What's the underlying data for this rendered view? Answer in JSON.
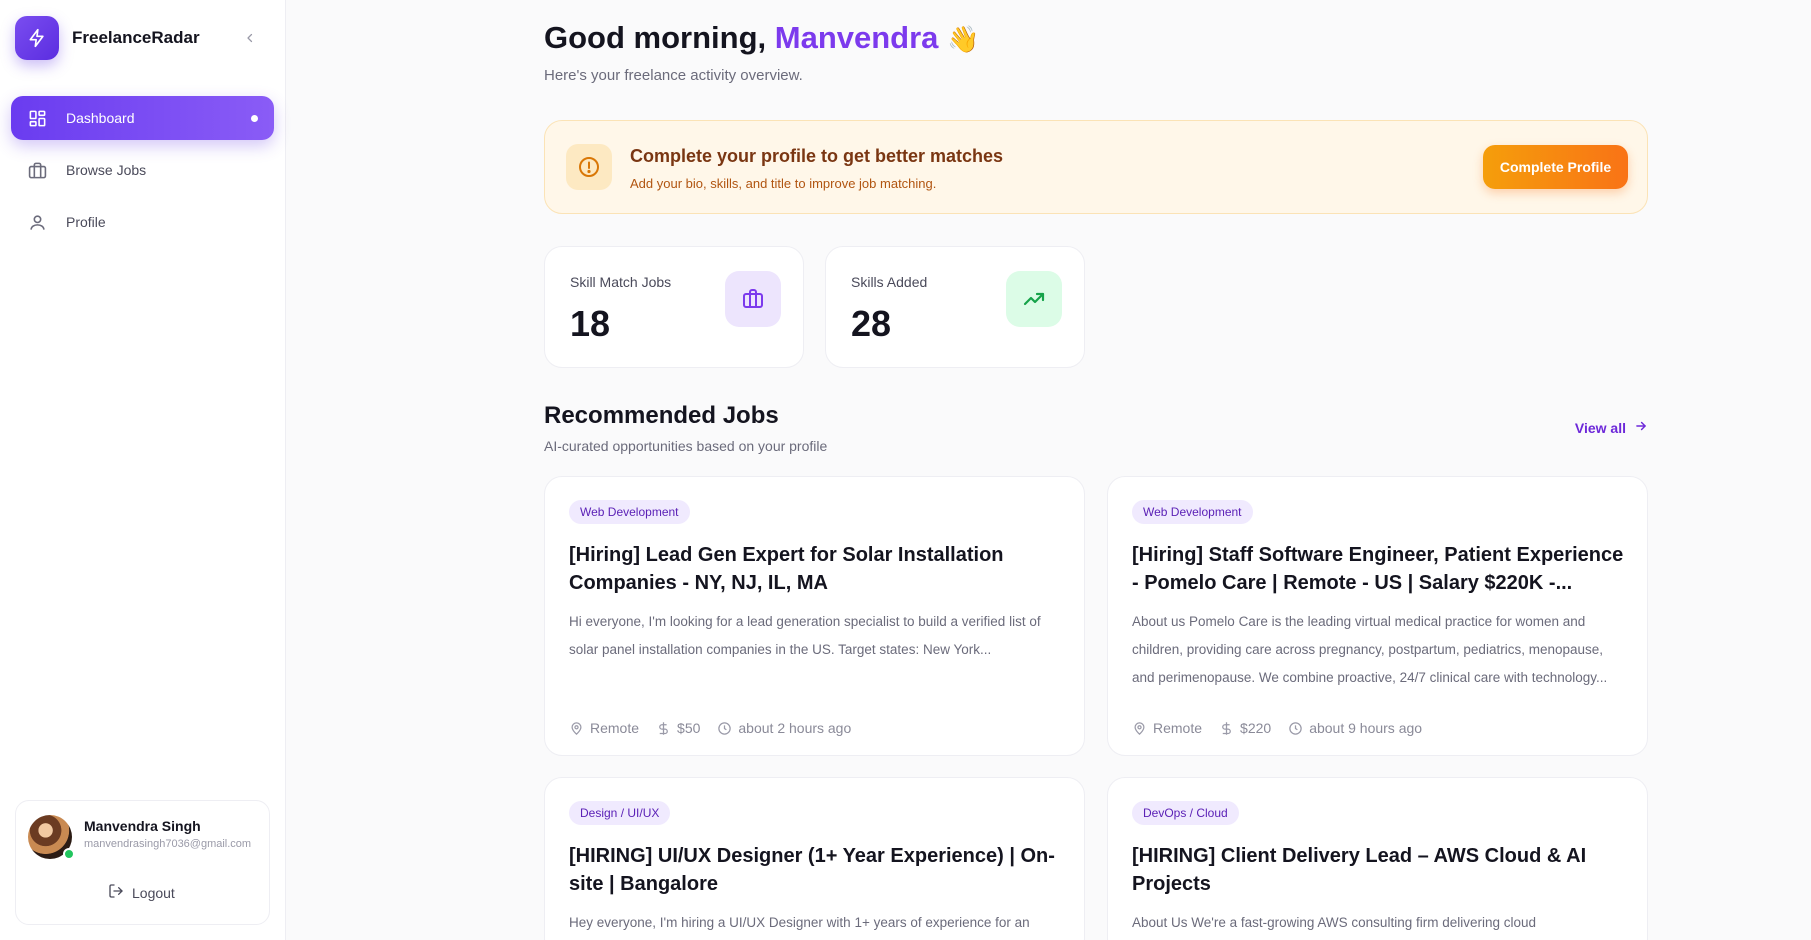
{
  "app": {
    "name": "FreelanceRadar"
  },
  "sidebar": {
    "items": [
      {
        "label": "Dashboard",
        "icon": "dashboard-grid-icon",
        "active": true
      },
      {
        "label": "Browse Jobs",
        "icon": "briefcase-icon",
        "active": false
      },
      {
        "label": "Profile",
        "icon": "user-icon",
        "active": false
      }
    ],
    "user": {
      "name": "Manvendra Singh",
      "email": "manvendrasingh7036@gmail.com",
      "status_color": "#22c55e"
    },
    "logout_label": "Logout"
  },
  "header": {
    "greeting_prefix": "Good morning,",
    "user_first_name": "Manvendra",
    "wave": "👋",
    "subtitle": "Here's your freelance activity overview."
  },
  "banner": {
    "title": "Complete your profile to get better matches",
    "text": "Add your bio, skills, and title to improve job matching.",
    "button_label": "Complete Profile",
    "icon": "alert-circle-icon"
  },
  "stats": [
    {
      "label": "Skill Match Jobs",
      "value": "18",
      "icon": "briefcase-icon",
      "accent": "#7c3aed"
    },
    {
      "label": "Skills Added",
      "value": "28",
      "icon": "trending-up-icon",
      "accent": "#16a34a"
    }
  ],
  "recommended": {
    "title": "Recommended Jobs",
    "subtitle": "AI-curated opportunities based on your profile",
    "view_all_label": "View all",
    "jobs": [
      {
        "tag": "Web Development",
        "title": "[Hiring] Lead Gen Expert for Solar Installation Companies - NY, NJ, IL, MA",
        "description": "Hi everyone, I'm looking for a lead generation specialist to build a verified list of solar panel installation companies in the US. Target states: New York...",
        "location": "Remote",
        "budget": "$50",
        "posted": "about 2 hours ago"
      },
      {
        "tag": "Web Development",
        "title": "[Hiring] Staff Software Engineer, Patient Experience - Pomelo Care | Remote - US | Salary $220K -...",
        "description": "About us Pomelo Care is the leading virtual medical practice for women and children, providing care across pregnancy, postpartum, pediatrics, menopause, and perimenopause. We combine proactive, 24/7 clinical care with technology...",
        "location": "Remote",
        "budget": "$220",
        "posted": "about 9 hours ago"
      },
      {
        "tag": "Design / UI/UX",
        "title": "[HIRING] UI/UX Designer (1+ Year Experience) | On-site | Bangalore",
        "description": "Hey everyone, I'm hiring a UI/UX Designer with 1+ years of experience for an",
        "location": "",
        "budget": "",
        "posted": ""
      },
      {
        "tag": "DevOps / Cloud",
        "title": "[HIRING] Client Delivery Lead – AWS Cloud & AI Projects",
        "description": "About Us We're a fast-growing AWS consulting firm delivering cloud",
        "location": "",
        "budget": "",
        "posted": ""
      }
    ]
  }
}
